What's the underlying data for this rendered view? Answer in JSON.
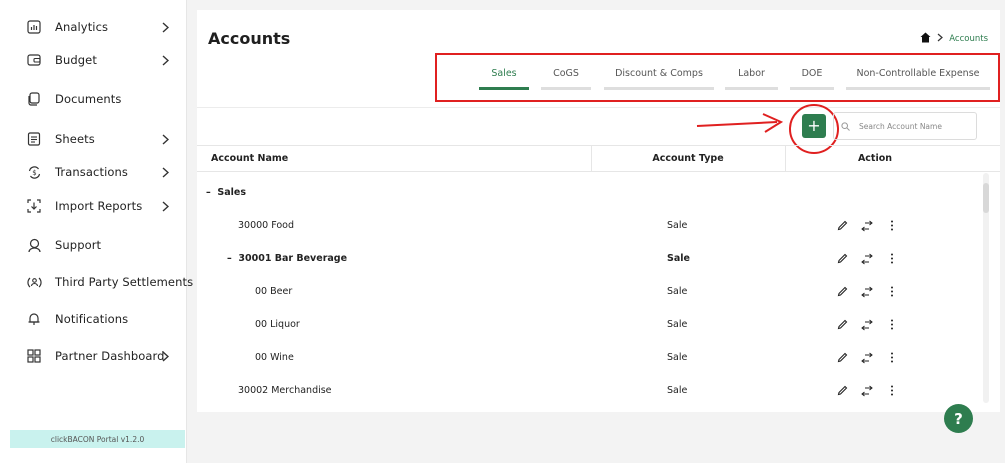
{
  "sidebar": {
    "items": [
      {
        "label": "Analytics",
        "icon": "analytics-icon",
        "has_chevron": true
      },
      {
        "label": "Budget",
        "icon": "wallet-icon",
        "has_chevron": true
      },
      {
        "label": "Documents",
        "icon": "documents-icon",
        "has_chevron": false
      },
      {
        "label": "Sheets",
        "icon": "sheet-icon",
        "has_chevron": true
      },
      {
        "label": "Transactions",
        "icon": "transactions-icon",
        "has_chevron": true
      },
      {
        "label": "Import Reports",
        "icon": "import-icon",
        "has_chevron": true
      },
      {
        "label": "Support",
        "icon": "support-icon",
        "has_chevron": false
      },
      {
        "label": "Third Party Settlements",
        "icon": "settlements-icon",
        "has_chevron": false
      },
      {
        "label": "Notifications",
        "icon": "bell-icon",
        "has_chevron": false
      },
      {
        "label": "Partner Dashboard",
        "icon": "dashboard-icon",
        "has_chevron": true
      }
    ],
    "version": "clickBACON Portal v1.2.0"
  },
  "header": {
    "title": "Accounts",
    "breadcrumb": {
      "current": "Accounts"
    }
  },
  "tabs": [
    {
      "label": "Sales",
      "active": true
    },
    {
      "label": "CoGS",
      "active": false
    },
    {
      "label": "Discount & Comps",
      "active": false
    },
    {
      "label": "Labor",
      "active": false
    },
    {
      "label": "DOE",
      "active": false
    },
    {
      "label": "Non-Controllable Expense",
      "active": false
    }
  ],
  "toolbar": {
    "add_label": "+",
    "search_placeholder": "Search Account Name"
  },
  "table": {
    "columns": [
      "Account Name",
      "Account Type",
      "Action"
    ],
    "group_label": "Sales",
    "group_prefix": "–",
    "rows": [
      {
        "name": "30000 Food",
        "type": "Sale",
        "bold": false,
        "prefix": ""
      },
      {
        "name": "30001 Bar Beverage",
        "type": "Sale",
        "bold": true,
        "prefix": "–"
      },
      {
        "name": "00 Beer",
        "type": "Sale",
        "bold": false,
        "prefix": ""
      },
      {
        "name": "00 Liquor",
        "type": "Sale",
        "bold": false,
        "prefix": ""
      },
      {
        "name": "00 Wine",
        "type": "Sale",
        "bold": false,
        "prefix": ""
      },
      {
        "name": "30002 Merchandise",
        "type": "Sale",
        "bold": false,
        "prefix": ""
      }
    ]
  },
  "help": {
    "label": "?"
  },
  "colors": {
    "accent": "#2e7d4f",
    "annotation": "#e02020",
    "version_bg": "#c9f2ee"
  }
}
